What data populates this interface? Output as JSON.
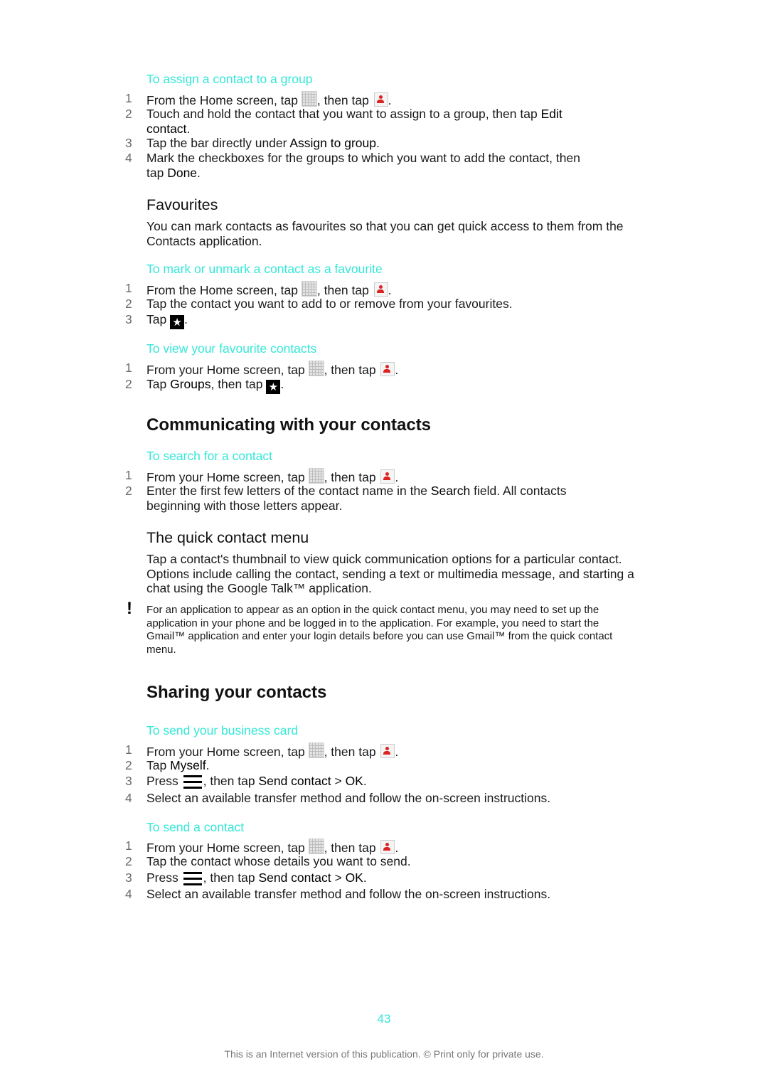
{
  "sections": {
    "assign_group": {
      "title": "To assign a contact to a group",
      "steps": [
        {
          "n": "1",
          "a": "From the Home screen, tap ",
          "b": ", then tap ",
          "c": "."
        },
        {
          "n": "2",
          "a": "Touch and hold the contact that you want to assign to a group, then tap ",
          "bold": "Edit contact",
          "c": "."
        },
        {
          "n": "3",
          "a": "Tap the bar directly under ",
          "bold": "Assign to group",
          "c": "."
        },
        {
          "n": "4",
          "a": "Mark the checkboxes for the groups to which you want to add the contact, then tap ",
          "bold": "Done",
          "c": "."
        }
      ]
    },
    "favourites": {
      "heading": "Favourites",
      "body": "You can mark contacts as favourites so that you can get quick access to them from the Contacts application."
    },
    "mark_favourite": {
      "title": "To mark or unmark a contact as a favourite",
      "steps": [
        {
          "n": "1",
          "a": "From the Home screen, tap ",
          "b": ", then tap ",
          "c": "."
        },
        {
          "n": "2",
          "a": "Tap the contact you want to add to or remove from your favourites."
        },
        {
          "n": "3",
          "a": "Tap ",
          "c": "."
        }
      ]
    },
    "view_favourites": {
      "title": "To view your favourite contacts",
      "steps": [
        {
          "n": "1",
          "a": "From your Home screen, tap ",
          "b": ", then tap ",
          "c": "."
        },
        {
          "n": "2",
          "a": "Tap ",
          "bold": "Groups",
          "b": ", then tap ",
          "c": "."
        }
      ]
    },
    "communicating": {
      "heading": "Communicating with your contacts"
    },
    "search": {
      "title": "To search for a contact",
      "steps": [
        {
          "n": "1",
          "a": "From your Home screen, tap ",
          "b": ", then tap ",
          "c": "."
        },
        {
          "n": "2",
          "a": "Enter the first few letters of the contact name in the ",
          "bold": "Search",
          "c": " field. All contacts beginning with those letters appear."
        }
      ]
    },
    "quick_menu": {
      "heading": "The quick contact menu",
      "body": "Tap a contact's thumbnail to view quick communication options for a particular contact. Options include calling the contact, sending a text or multimedia message, and starting a chat using the Google Talk™ application.",
      "note": "For an application to appear as an option in the quick contact menu, you may need to set up the application in your phone and be logged in to the application. For example, you need to start the Gmail™ application and enter your login details before you can use Gmail™ from the quick contact menu.",
      "note_icon": "!"
    },
    "sharing": {
      "heading": "Sharing your contacts"
    },
    "business_card": {
      "title": "To send your business card",
      "steps": [
        {
          "n": "1",
          "a": "From your Home screen, tap ",
          "b": ", then tap ",
          "c": "."
        },
        {
          "n": "2",
          "a": "Tap ",
          "bold": "Myself",
          "c": "."
        },
        {
          "n": "3",
          "a": "Press ",
          "b": ", then tap ",
          "bold": "Send contact",
          "gt": " > ",
          "bold2": "OK",
          "c": "."
        },
        {
          "n": "4",
          "a": "Select an available transfer method and follow the on-screen instructions."
        }
      ]
    },
    "send_contact": {
      "title": "To send a contact",
      "steps": [
        {
          "n": "1",
          "a": "From your Home screen, tap ",
          "b": ", then tap ",
          "c": "."
        },
        {
          "n": "2",
          "a": "Tap the contact whose details you want to send."
        },
        {
          "n": "3",
          "a": "Press ",
          "b": ", then tap ",
          "bold": "Send contact",
          "gt": " > ",
          "bold2": "OK",
          "c": "."
        },
        {
          "n": "4",
          "a": "Select an available transfer method and follow the on-screen instructions."
        }
      ]
    }
  },
  "page_number": "43",
  "footer": "This is an Internet version of this publication. © Print only for private use.",
  "icons": {
    "star": "★"
  }
}
